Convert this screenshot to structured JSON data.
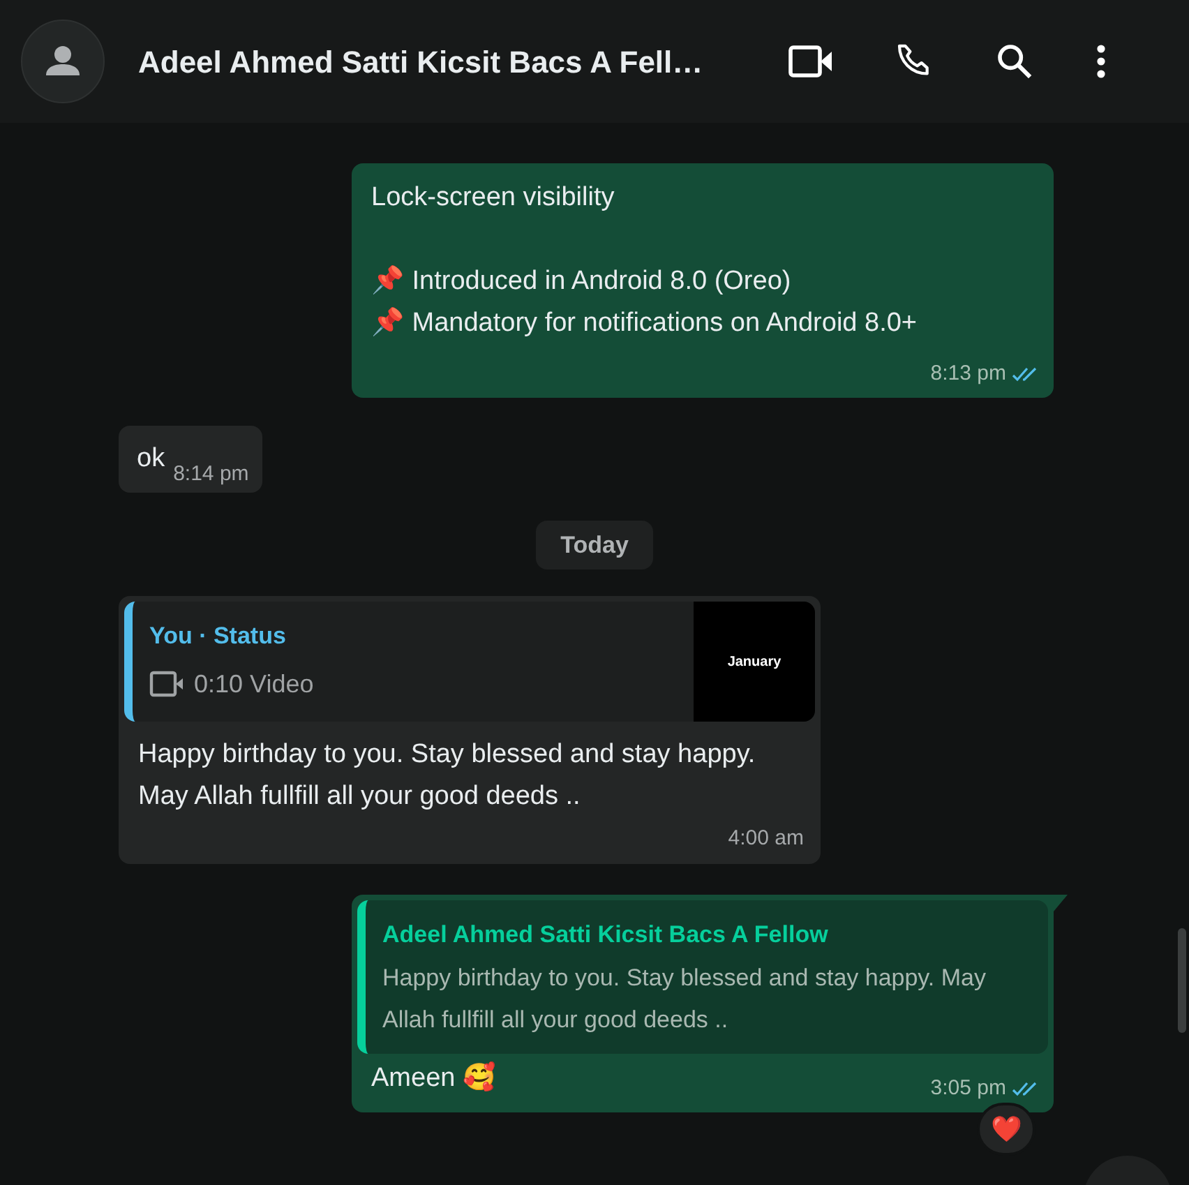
{
  "header": {
    "title": "Adeel Ahmed Satti Kicsit Bacs A Fell…"
  },
  "messages": [
    {
      "kind": "outgoing",
      "paragraphs": [
        "Lock-screen visibility",
        "📌 Introduced in Android 8.0 (Oreo)\n📌 Mandatory for notifications on Android 8.0+"
      ],
      "time": "8:13 pm",
      "read": true
    },
    {
      "kind": "incoming_short",
      "text": "ok",
      "time": "8:14 pm"
    },
    {
      "kind": "date",
      "text": "Today"
    },
    {
      "kind": "status_reply",
      "quote": {
        "author": "You · Status",
        "media": "0:10 Video",
        "thumbnail_text": "January"
      },
      "text": "Happy birthday to you. Stay blessed and stay happy. May Allah fullfill all your good deeds ..",
      "time": "4:00 am"
    },
    {
      "kind": "outgoing_reply",
      "quote": {
        "author": "Adeel Ahmed Satti Kicsit Bacs A Fellow",
        "text": "Happy birthday to you. Stay blessed and stay happy. May Allah fullfill all your good deeds .."
      },
      "text": "Ameen 🥰",
      "time": "3:05 pm",
      "read": true,
      "reaction": "❤️"
    }
  ]
}
